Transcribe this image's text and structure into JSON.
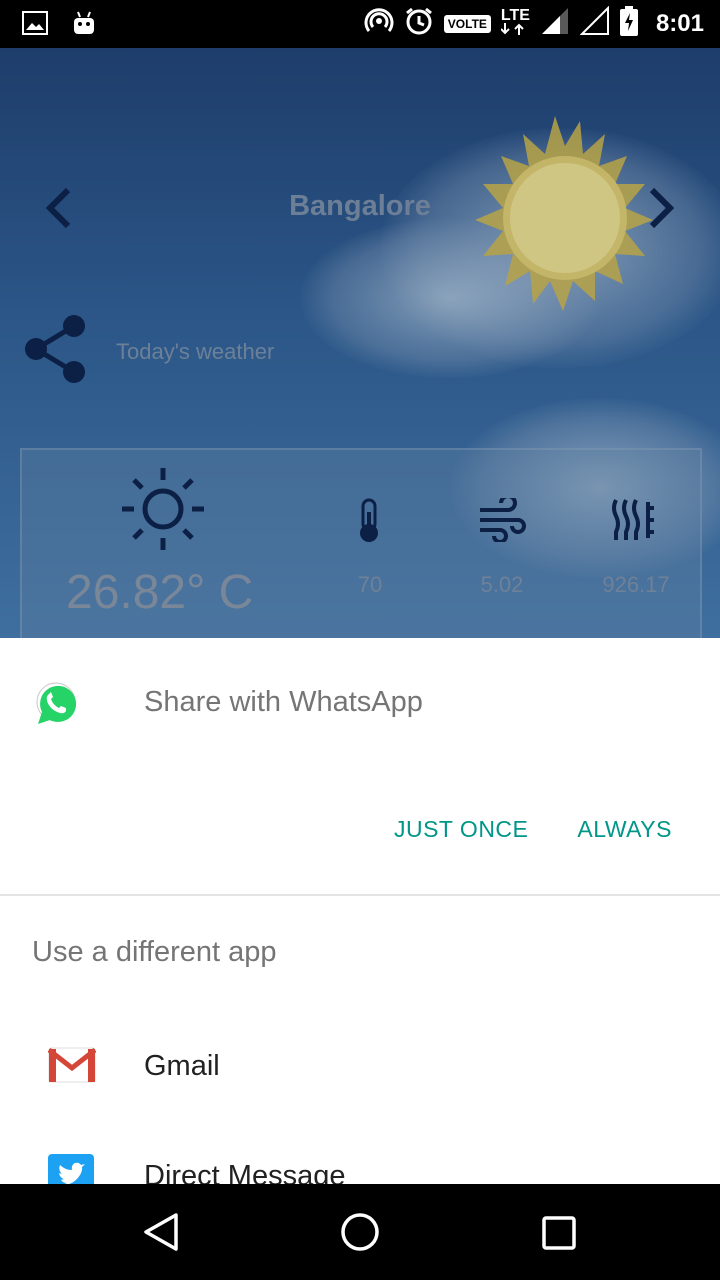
{
  "status_bar": {
    "time": "8:01",
    "volte": "VOLTE",
    "network": "LTE",
    "icons": [
      "image-icon",
      "android-icon",
      "hotspot-icon",
      "alarm-icon",
      "signal-icon",
      "signal-empty-icon",
      "battery-charging-icon"
    ]
  },
  "app": {
    "city": "Bangalore",
    "share_label": "Today's weather",
    "temperature": "26.82° C",
    "stats": {
      "humidity": "70",
      "wind": "5.02",
      "pressure": "926.17"
    }
  },
  "share_sheet": {
    "primary_app_label": "Share with WhatsApp",
    "just_once": "JUST ONCE",
    "always": "ALWAYS",
    "different_app_label": "Use a different app",
    "apps": [
      {
        "label": "Gmail",
        "icon": "gmail-icon"
      },
      {
        "label": "Direct Message",
        "icon": "twitter-icon"
      }
    ]
  },
  "colors": {
    "accent": "#009688",
    "whatsapp_green": "#25D366",
    "gmail_red": "#D44638",
    "twitter_blue": "#1DA1F2"
  }
}
